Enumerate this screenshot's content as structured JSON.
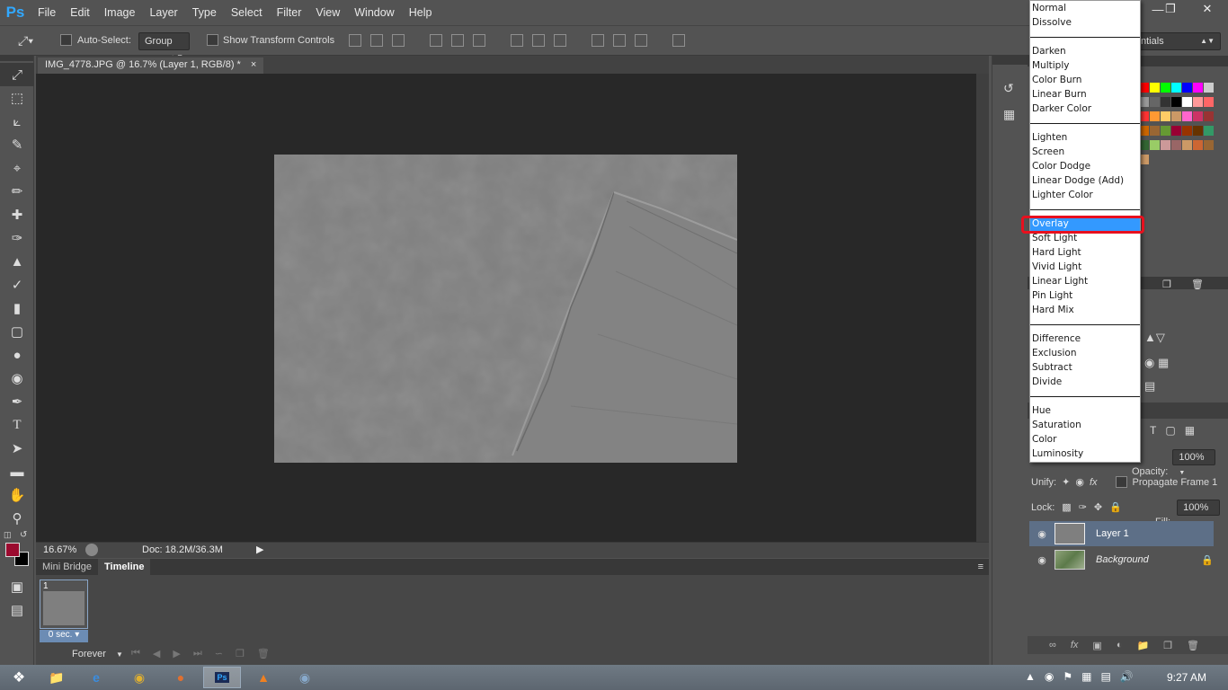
{
  "app": {
    "logo": "Ps"
  },
  "menu": [
    "File",
    "Edit",
    "Image",
    "Layer",
    "Type",
    "Select",
    "Filter",
    "View",
    "Window",
    "Help"
  ],
  "options": {
    "auto_select_label": "Auto-Select:",
    "auto_select_value": "Group",
    "show_transform_label": "Show Transform Controls",
    "workspace_partial": "ntials"
  },
  "document": {
    "tab_title": "IMG_4778.JPG @ 16.7% (Layer 1, RGB/8) *",
    "zoom": "16.67%",
    "doc_size": "Doc: 18.2M/36.3M"
  },
  "timeline": {
    "tabs": [
      "Mini Bridge",
      "Timeline"
    ],
    "frame_number": "1",
    "frame_delay": "0 sec.",
    "loop": "Forever"
  },
  "blend_modes": {
    "groups": [
      [
        "Normal",
        "Dissolve"
      ],
      [
        "Darken",
        "Multiply",
        "Color Burn",
        "Linear Burn",
        "Darker Color"
      ],
      [
        "Lighten",
        "Screen",
        "Color Dodge",
        "Linear Dodge (Add)",
        "Lighter Color"
      ],
      [
        "Overlay",
        "Soft Light",
        "Hard Light",
        "Vivid Light",
        "Linear Light",
        "Pin Light",
        "Hard Mix"
      ],
      [
        "Difference",
        "Exclusion",
        "Subtract",
        "Divide"
      ],
      [
        "Hue",
        "Saturation",
        "Color",
        "Luminosity"
      ]
    ],
    "selected": "Overlay"
  },
  "layers_panel": {
    "opacity_label": "Opacity:",
    "opacity_value": "100%",
    "unify_label": "Unify:",
    "propagate_label": "Propagate Frame 1",
    "lock_label": "Lock:",
    "fill_label": "Fill:",
    "fill_value": "100%",
    "layers": [
      {
        "name": "Layer 1",
        "selected": true
      },
      {
        "name": "Background",
        "selected": false
      }
    ]
  },
  "taskbar": {
    "time": "9:27 AM"
  },
  "colors": {
    "foreground": "#9b0a2f",
    "background": "#000000",
    "selection_blue": "#3399ff",
    "highlight_red": "#e8101e"
  }
}
